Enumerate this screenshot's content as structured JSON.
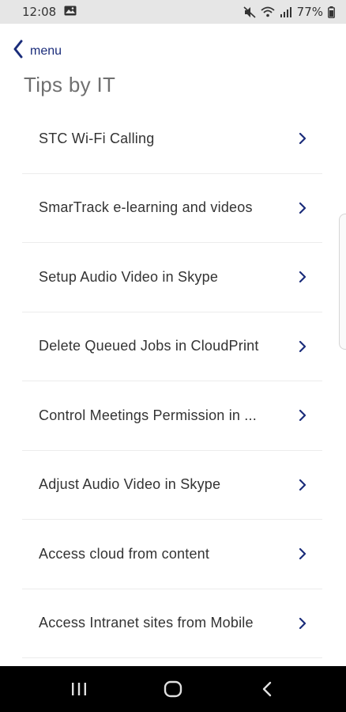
{
  "status_bar": {
    "time": "12:08",
    "battery": "77%",
    "icons": [
      "image-icon",
      "mute-icon",
      "wifi-icon",
      "signal-icon",
      "battery-icon"
    ]
  },
  "header": {
    "back_label": "menu",
    "title": "Tips by IT"
  },
  "list": {
    "items": [
      {
        "label": "STC Wi-Fi Calling"
      },
      {
        "label": "SmarTrack e-learning and videos"
      },
      {
        "label": "Setup Audio Video in Skype"
      },
      {
        "label": "Delete Queued Jobs in CloudPrint"
      },
      {
        "label": "Control Meetings Permission in ..."
      },
      {
        "label": "Adjust Audio Video in Skype"
      },
      {
        "label": "Access cloud from content"
      },
      {
        "label": "Access Intranet sites from Mobile"
      }
    ]
  },
  "nav_bar": {
    "buttons": [
      "recents-icon",
      "home-icon",
      "back-icon"
    ]
  },
  "colors": {
    "accent": "#1a2c7a",
    "title": "#707070",
    "text": "#333333",
    "status_bar": "#e6e6e6",
    "nav_bar": "#000000"
  }
}
